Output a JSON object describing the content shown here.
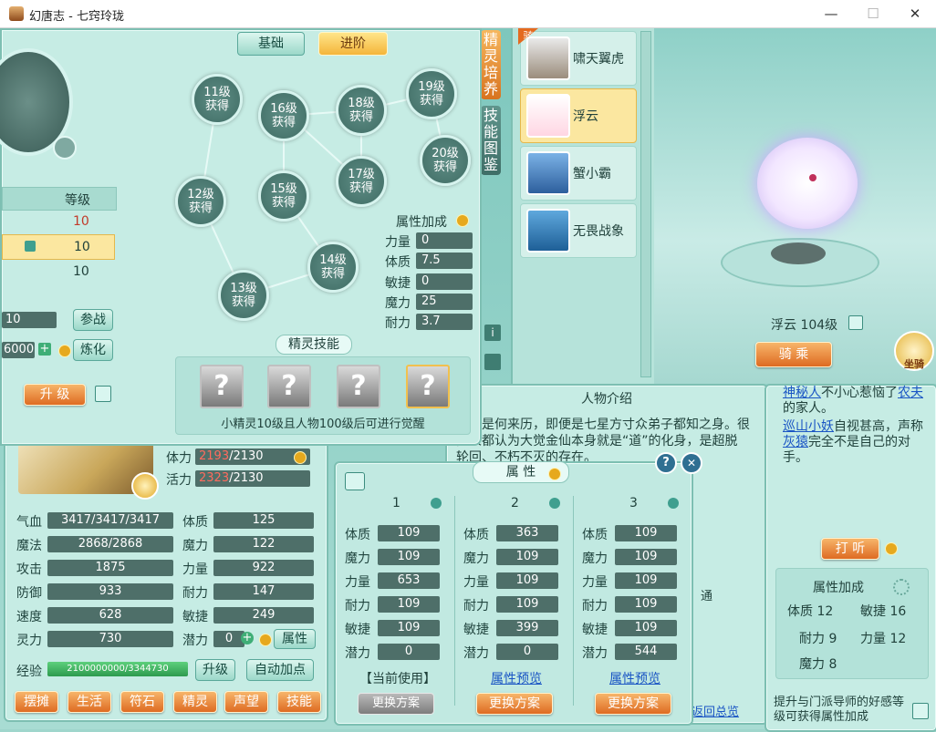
{
  "window": {
    "title": "幻唐志 - 七窍玲珑",
    "min": "—",
    "max": "☐",
    "close": "✕"
  },
  "char_panel": {
    "table_header": "等级",
    "rows": [
      "10",
      "10",
      "10"
    ],
    "battle_value": "10",
    "battle_btn": "参战",
    "refine_value": "6000",
    "refine_btn": "炼化",
    "upgrade_btn": "升 级",
    "tili_label": "体力",
    "tili_cur": "2193",
    "tili_max": "/2130",
    "huoli_label": "活力",
    "huoli_cur": "2323",
    "huoli_max": "/2130",
    "stats_left": [
      {
        "label": "气血",
        "value": "3417/3417/3417"
      },
      {
        "label": "魔法",
        "value": "2868/2868"
      },
      {
        "label": "攻击",
        "value": "1875"
      },
      {
        "label": "防御",
        "value": "933"
      },
      {
        "label": "速度",
        "value": "628"
      },
      {
        "label": "灵力",
        "value": "730"
      }
    ],
    "stats_right": [
      {
        "label": "体质",
        "value": "125"
      },
      {
        "label": "魔力",
        "value": "122"
      },
      {
        "label": "力量",
        "value": "922"
      },
      {
        "label": "耐力",
        "value": "147"
      },
      {
        "label": "敏捷",
        "value": "249"
      }
    ],
    "potential_label": "潜力",
    "potential_value": "0",
    "attr_btn": "属性",
    "exp_label": "经验",
    "exp_value": "2100000000/3344730",
    "exp_upgrade_btn": "升级",
    "auto_btn": "自动加点",
    "bottom_tabs": [
      "摆摊",
      "生活",
      "符石",
      "精灵",
      "声望",
      "技能"
    ]
  },
  "spirit_panel": {
    "tab_basic": "基础",
    "tab_advanced": "进阶",
    "nodes": [
      "11级\n获得",
      "16级\n获得",
      "18级\n获得",
      "19级\n获得",
      "20级\n获得",
      "12级\n获得",
      "15级\n获得",
      "17级\n获得",
      "14级\n获得",
      "13级\n获得"
    ],
    "bonus_title": "属性加成",
    "bonus": [
      {
        "label": "力量",
        "value": "0"
      },
      {
        "label": "体质",
        "value": "7.5"
      },
      {
        "label": "敏捷",
        "value": "0"
      },
      {
        "label": "魔力",
        "value": "25"
      },
      {
        "label": "耐力",
        "value": "3.7"
      }
    ],
    "skill_title": "精灵技能",
    "skill_slot": "?",
    "skill_note": "小精灵10级且人物100级后可进行觉醒"
  },
  "side_tabs": {
    "tab1": "精灵培养",
    "tab2": "技能图鉴",
    "ride_badge": "骑"
  },
  "pets": [
    {
      "name": "啸天翼虎"
    },
    {
      "name": "浮云"
    },
    {
      "name": "蟹小霸"
    },
    {
      "name": "无畏战象"
    }
  ],
  "mount": {
    "name_level": "浮云 104级",
    "ride_btn": "骑 乘",
    "mount_badge": "坐骑"
  },
  "intro": {
    "title": "人物介绍",
    "text": "金仙是何来历，即便是七星方寸众弟子都知之身。很多人都认为大觉金仙本身就是“道”的化身，是超脱轮回、不朽不灭的存在。",
    "partial_label": "通",
    "back_link": "返回总览"
  },
  "npc": {
    "line1_link": "神秘人",
    "line1_text": "不小心惹恼了",
    "line1_link2": "农夫",
    "line1_end": "的家人。",
    "line2_link": "巡山小妖",
    "line2_text": "自视甚高，声称",
    "line2_link2": "灰猿",
    "line2_end": "完全不是自己的对手。",
    "listen_btn": "打 听",
    "bonus_title": "属性加成",
    "bonus": [
      {
        "label": "体质",
        "value": "12"
      },
      {
        "label": "敏捷",
        "value": "16"
      },
      {
        "label": "耐力",
        "value": "9"
      },
      {
        "label": "力量",
        "value": "12"
      },
      {
        "label": "魔力",
        "value": "8"
      }
    ],
    "footer": "提升与门派导师的好感等级可获得属性加成"
  },
  "attr_popup": {
    "title": "属 性",
    "help": "?",
    "close": "✕",
    "columns": [
      {
        "num": "1",
        "stats": [
          [
            "体质",
            "109"
          ],
          [
            "魔力",
            "109"
          ],
          [
            "力量",
            "653"
          ],
          [
            "耐力",
            "109"
          ],
          [
            "敏捷",
            "109"
          ],
          [
            "潜力",
            "0"
          ]
        ],
        "footer": "【当前使用】",
        "btn": "更换方案"
      },
      {
        "num": "2",
        "stats": [
          [
            "体质",
            "363"
          ],
          [
            "魔力",
            "109"
          ],
          [
            "力量",
            "109"
          ],
          [
            "耐力",
            "109"
          ],
          [
            "敏捷",
            "399"
          ],
          [
            "潜力",
            "0"
          ]
        ],
        "footer": "属性预览",
        "btn": "更换方案"
      },
      {
        "num": "3",
        "stats": [
          [
            "体质",
            "109"
          ],
          [
            "魔力",
            "109"
          ],
          [
            "力量",
            "109"
          ],
          [
            "耐力",
            "109"
          ],
          [
            "敏捷",
            "109"
          ],
          [
            "潜力",
            "544"
          ]
        ],
        "footer": "属性预览",
        "btn": "更换方案"
      }
    ]
  }
}
